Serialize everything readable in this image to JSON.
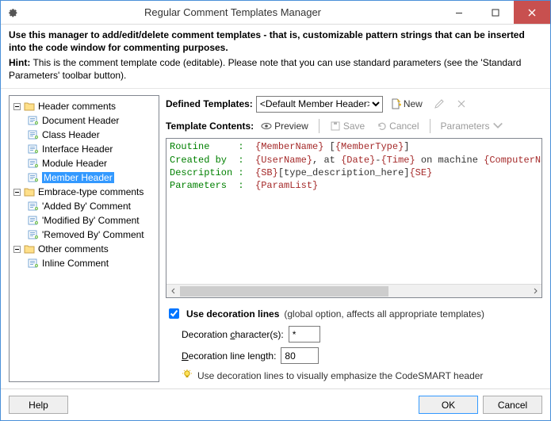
{
  "window": {
    "title": "Regular Comment Templates Manager"
  },
  "header": {
    "instruction": "Use this manager to add/edit/delete comment templates - that is, customizable pattern strings that can be inserted into the code window for commenting purposes.",
    "hint_label": "Hint:",
    "hint_text": "This is the comment template code (editable). Please note that you can use standard parameters (see the 'Standard Parameters' toolbar button)."
  },
  "tree": {
    "groups": [
      {
        "label": "Header comments",
        "items": [
          "Document Header",
          "Class Header",
          "Interface Header",
          "Module Header",
          "Member Header"
        ],
        "selected": 4
      },
      {
        "label": "Embrace-type comments",
        "items": [
          "'Added By' Comment",
          "'Modified By' Comment",
          "'Removed By' Comment"
        ],
        "selected": -1
      },
      {
        "label": "Other comments",
        "items": [
          "Inline Comment"
        ],
        "selected": -1
      }
    ]
  },
  "defined": {
    "label": "Defined Templates:",
    "selected": "<Default Member Header>",
    "new_label": "New"
  },
  "contents": {
    "label": "Template Contents:",
    "preview": "Preview",
    "save": "Save",
    "cancel": "Cancel",
    "parameters": "Parameters"
  },
  "code": {
    "lines": [
      {
        "kw": "Routine     :  ",
        "tokens": [
          "{MemberName}",
          " [",
          "{MemberType}",
          "]"
        ]
      },
      {
        "kw": "Created by  :  ",
        "tokens": [
          "{UserName}",
          ", at ",
          "{Date}",
          "-",
          "{Time}",
          " on machine ",
          "{ComputerName}"
        ]
      },
      {
        "kw": "Description :  ",
        "tokens": [
          "{SB}",
          "[type_description_here]",
          "{SE}"
        ]
      },
      {
        "kw": "Parameters  :  ",
        "tokens": [
          "{ParamList}"
        ]
      }
    ]
  },
  "decoration": {
    "use_label": "Use decoration lines",
    "use_note": "(global option, affects all appropriate templates)",
    "char_label_pre": "Decoration ",
    "char_label_u": "c",
    "char_label_post": "haracter(s):",
    "char_value": "*",
    "len_label_u": "D",
    "len_label_post": "ecoration line length:",
    "len_value": "80",
    "hint": "Use decoration lines to visually emphasize the CodeSMART header"
  },
  "buttons": {
    "help": "Help",
    "ok": "OK",
    "cancel": "Cancel"
  }
}
